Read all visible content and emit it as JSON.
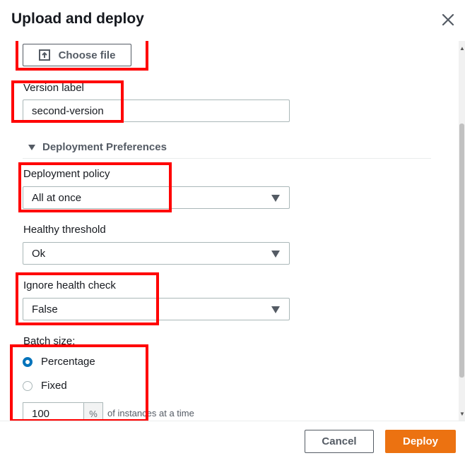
{
  "dialog": {
    "title": "Upload and deploy",
    "close_icon": "close-icon"
  },
  "upload": {
    "choose_file_label": "Choose file",
    "icon": "upload-icon"
  },
  "version": {
    "label": "Version label",
    "value": "second-version"
  },
  "preferences": {
    "section_label": "Deployment Preferences",
    "deployment_policy": {
      "label": "Deployment policy",
      "value": "All at once"
    },
    "healthy_threshold": {
      "label": "Healthy threshold",
      "value": "Ok"
    },
    "ignore_health_check": {
      "label": "Ignore health check",
      "value": "False"
    }
  },
  "batch": {
    "label": "Batch size:",
    "options": [
      {
        "label": "Percentage",
        "selected": true
      },
      {
        "label": "Fixed",
        "selected": false
      }
    ],
    "value": "100",
    "unit": "%",
    "suffix": "of instances at a time"
  },
  "footer": {
    "cancel_label": "Cancel",
    "deploy_label": "Deploy"
  },
  "colors": {
    "accent": "#ec7211",
    "radio_selected": "#0073bb",
    "highlight": "#ff0000"
  }
}
